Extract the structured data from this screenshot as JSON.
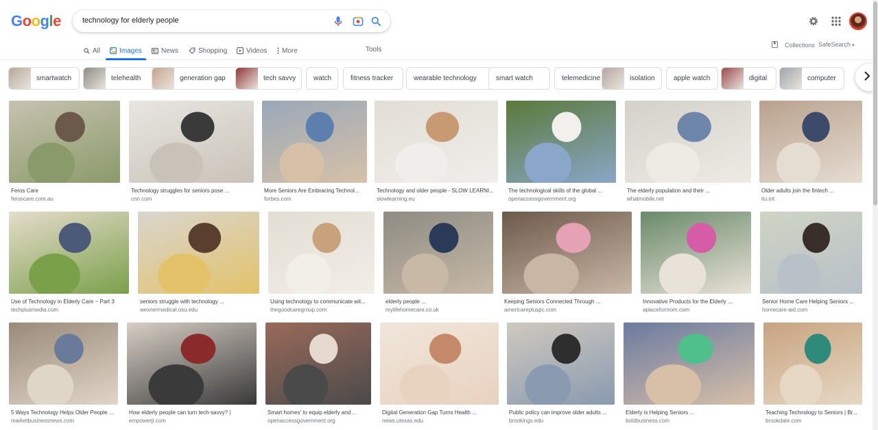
{
  "logo": {
    "letters": [
      "G",
      "o",
      "o",
      "g",
      "l",
      "e"
    ],
    "colors": [
      "#4285f4",
      "#ea4335",
      "#fbbc05",
      "#4285f4",
      "#34a853",
      "#ea4335"
    ]
  },
  "search": {
    "query": "technology for elderly people"
  },
  "tabs": [
    {
      "label": "All",
      "icon": "search-icon"
    },
    {
      "label": "Images",
      "icon": "image-icon",
      "active": true
    },
    {
      "label": "News",
      "icon": "news-icon"
    },
    {
      "label": "Shopping",
      "icon": "tag-icon"
    },
    {
      "label": "Videos",
      "icon": "play-icon"
    },
    {
      "label": "More",
      "icon": "more-vert-icon"
    }
  ],
  "tools_label": "Tools",
  "collections_label": "Collections",
  "safesearch_label": "SafeSearch",
  "chips": [
    {
      "label": "smartwatch",
      "thumb": "#b7a99a"
    },
    {
      "label": "telehealth",
      "thumb": "#8e8c86"
    },
    {
      "label": "generation gap",
      "thumb": "#c6a58c"
    },
    {
      "label": "tech savvy",
      "thumb": "#8e3a3a"
    },
    {
      "label": "watch"
    },
    {
      "label": "fitness tracker"
    },
    {
      "label": "wearable technology"
    },
    {
      "label": "smart watch"
    },
    {
      "label": "telemedicine"
    },
    {
      "label": "isolation",
      "thumb": "#b4a7a0"
    },
    {
      "label": "apple watch"
    },
    {
      "label": "digital",
      "thumb": "#9a4d4d"
    },
    {
      "label": "computer",
      "thumb": "#9fa4aa"
    }
  ],
  "results": [
    {
      "title": "Feros Care",
      "site": "feroscare.com.au",
      "colors": [
        "#c7c2b0",
        "#6b5a4a",
        "#8a9a6a"
      ]
    },
    {
      "title": "Technology struggles for seniors pose ...",
      "site": "cnn.com",
      "colors": [
        "#e8e6e2",
        "#3a3a3a",
        "#c9c2b8"
      ]
    },
    {
      "title": "More Seniors Are Embracing Technol...",
      "site": "forbes.com",
      "colors": [
        "#9aa8b8",
        "#5d7fae",
        "#d6c1a8"
      ]
    },
    {
      "title": "Technology and older people - SLOW LEARNI...",
      "site": "slowlearning.eu",
      "colors": [
        "#e2ddd6",
        "#c89a74",
        "#f0eeea"
      ]
    },
    {
      "title": "The technological skills of the global ...",
      "site": "openaccessgovernment.org",
      "colors": [
        "#5a7a3a",
        "#f2f0ec",
        "#8aa6c8"
      ]
    },
    {
      "title": "The elderly population and their ...",
      "site": "whatmobile.net",
      "colors": [
        "#d4d0ca",
        "#6e86aa",
        "#eeeae4"
      ]
    },
    {
      "title": "Older adults join the fintech ...",
      "site": "itu.int",
      "colors": [
        "#b9a28e",
        "#3d4a6a",
        "#e6ddd2"
      ]
    },
    {
      "title": "Use of Technology in Elderly Care ~ Part 3",
      "site": "techplusmedia.com",
      "colors": [
        "#e6dccc",
        "#4a5a78",
        "#7aa04a"
      ]
    },
    {
      "title": "seniors struggle with technology ...",
      "site": "wexnermedical.osu.edu",
      "colors": [
        "#d9d6cf",
        "#5a3e2e",
        "#e3c26a"
      ]
    },
    {
      "title": "Using technology to communicate wit...",
      "site": "thegoodcaregroup.com",
      "colors": [
        "#e2ddd4",
        "#c8a27a",
        "#f2eee8"
      ]
    },
    {
      "title": "elderly people ...",
      "site": "mylifehomecare.co.uk",
      "colors": [
        "#8e8c84",
        "#2c3a5a",
        "#c7b9a6"
      ]
    },
    {
      "title": "Keeping Seniors Connected Through ...",
      "site": "americarepluspc.com",
      "colors": [
        "#6e5a4c",
        "#e4a2b4",
        "#c9b7a6"
      ]
    },
    {
      "title": "Innovative Products for the Elderly ...",
      "site": "aplaceformom.com",
      "colors": [
        "#6a8a6a",
        "#d65ca8",
        "#e8e2d8"
      ]
    },
    {
      "title": "Senior Home Care Helping Seniors ...",
      "site": "homecare-aid.com",
      "colors": [
        "#cfd4c4",
        "#3a2e2a",
        "#b8c0c8"
      ]
    },
    {
      "title": "5 Ways Technology Helps Older People ...",
      "site": "marketbusinessnews.com",
      "colors": [
        "#9a8a7a",
        "#6a7a9a",
        "#e0d6c8"
      ]
    },
    {
      "title": "How elderly people can turn tech-savvy? |",
      "site": "empowerji.com",
      "colors": [
        "#d8cfc6",
        "#8a2a2a",
        "#3a3a3a"
      ]
    },
    {
      "title": "Smart homes' to equip elderly and ...",
      "site": "openaccessgovernment.org",
      "colors": [
        "#9a6a5a",
        "#e6dad0",
        "#4a4a4a"
      ]
    },
    {
      "title": "Digital Generation Gap Turns Health ...",
      "site": "news.utexas.edu",
      "colors": [
        "#f0e6da",
        "#c48a6a",
        "#e8d2c0"
      ]
    },
    {
      "title": "Public policy can improve older adults ...",
      "site": "brookings.edu",
      "colors": [
        "#cfc9bf",
        "#2e2e2e",
        "#8a9ab0"
      ]
    },
    {
      "title": "Elderly is Helping Seniors ...",
      "site": "boldbusiness.com",
      "colors": [
        "#6a7aa0",
        "#4fc08a",
        "#d8c0a8"
      ]
    },
    {
      "title": "Teaching Technology to Seniors | Br...",
      "site": "brookdale.com",
      "colors": [
        "#c8a480",
        "#2e8a7a",
        "#e6d8c4"
      ]
    }
  ]
}
